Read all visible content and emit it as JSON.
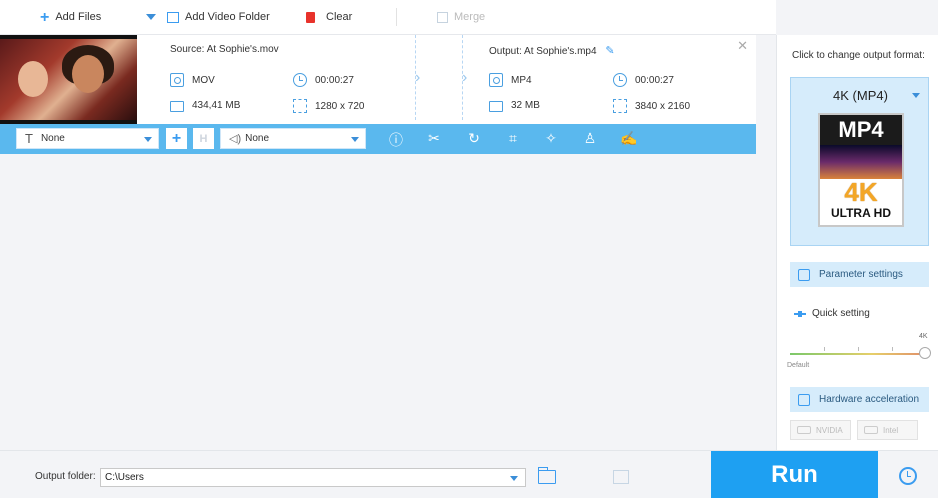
{
  "toolbar": {
    "add_files": "Add Files",
    "add_video_folder": "Add Video Folder",
    "clear": "Clear",
    "merge": "Merge"
  },
  "file": {
    "source_title": "Source: At Sophie's.mov",
    "output_title": "Output: At Sophie's.mp4",
    "source": {
      "format": "MOV",
      "duration": "00:00:27",
      "size": "434,41 MB",
      "resolution": "1280 x 720"
    },
    "output": {
      "format": "MP4",
      "duration": "00:00:27",
      "size": "32 MB",
      "resolution": "3840 x 2160"
    }
  },
  "editbar": {
    "subtitle": "None",
    "audio": "None",
    "tools": [
      "info-icon",
      "cut-icon",
      "rotate-icon",
      "crop-icon",
      "effects-icon",
      "watermark-icon",
      "edit-icon"
    ]
  },
  "right_panel": {
    "title": "Click to change output format:",
    "format_label": "4K (MP4)",
    "format_icon": {
      "top": "MP4",
      "mid": "4K",
      "bottom": "ULTRA HD"
    },
    "parameter_settings": "Parameter settings",
    "quick_setting": "Quick setting",
    "slider_max": "4K",
    "slider_min": "Default",
    "slider_level": 1.0,
    "hardware_acceleration": "Hardware acceleration",
    "hw_nvidia": "NVIDIA",
    "hw_intel": "Intel"
  },
  "bottom": {
    "output_folder_label": "Output folder:",
    "output_folder_value": "C:\\Users",
    "run": "Run"
  },
  "colors": {
    "accent": "#1ea0f2",
    "editbar": "#5ab8ee",
    "format_bg": "#d6ecfb"
  }
}
